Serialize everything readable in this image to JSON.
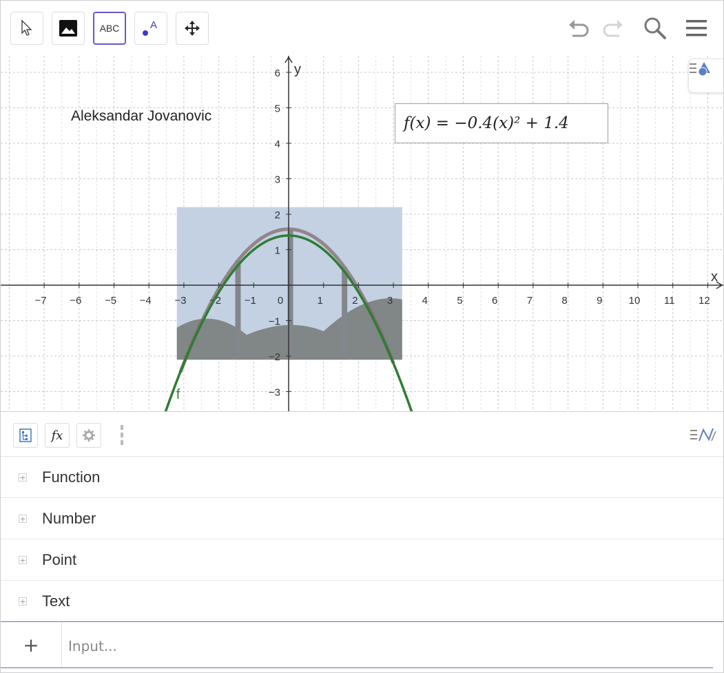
{
  "toolbar": {
    "tools": [
      "move-tool",
      "image-tool",
      "text-tool",
      "point-label-tool",
      "move-graphics-tool"
    ],
    "text_tool_label": "ABC",
    "point_label_letter": "A"
  },
  "graphics": {
    "author": "Aleksandar Jovanovic",
    "formula": "f(x) = −0.4(x)² + 1.4",
    "curve_label": "f",
    "x_axis_label": "x",
    "y_axis_label": "y",
    "x_ticks": [
      "−7",
      "−6",
      "−5",
      "−4",
      "−3",
      "−2",
      "−1",
      "0",
      "1",
      "2",
      "3",
      "4",
      "5",
      "6",
      "7",
      "8",
      "9",
      "10",
      "11",
      "12"
    ],
    "y_ticks": [
      "6",
      "5",
      "4",
      "3",
      "2",
      "1",
      "−1",
      "−2",
      "−3"
    ],
    "function": {
      "a": -0.4,
      "b": 0,
      "c": 1.4
    },
    "colors": {
      "curve": "#2e7d32",
      "grid": "#c8c8c8",
      "axis": "#333333",
      "accent": "#6557d2"
    }
  },
  "algebra": {
    "groups": [
      "Function",
      "Number",
      "Point",
      "Text"
    ],
    "input_placeholder": "Input...",
    "input_plus": "+"
  }
}
